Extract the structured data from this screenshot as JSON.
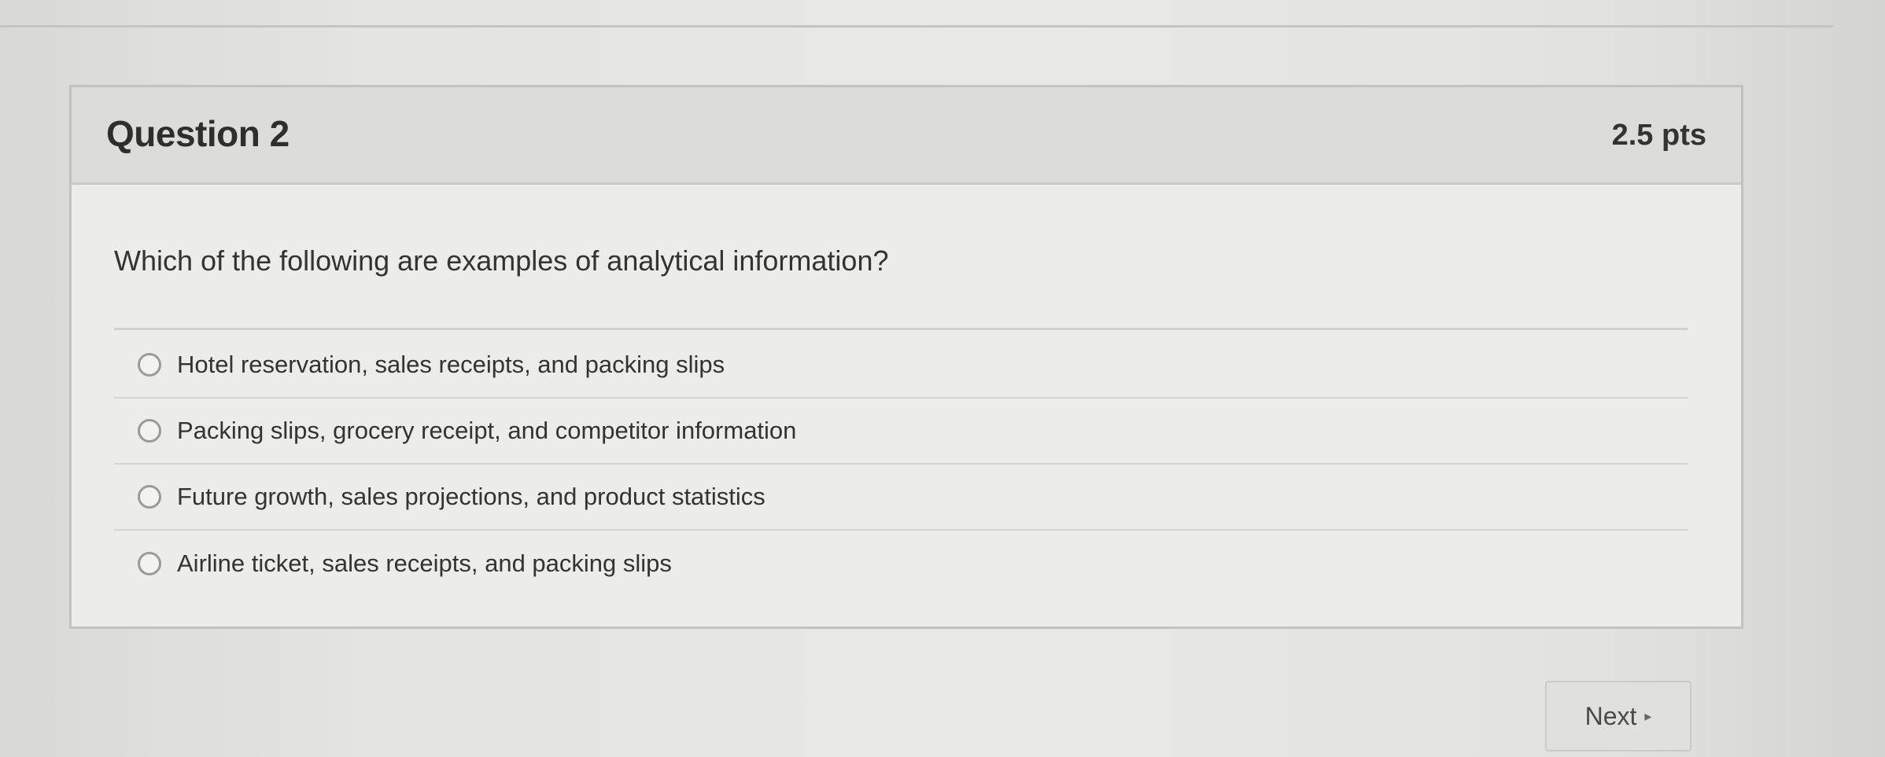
{
  "question": {
    "title": "Question 2",
    "points": "2.5 pts",
    "text": "Which of the following are examples of analytical information?",
    "answers": [
      {
        "label": "Hotel reservation, sales receipts, and packing slips",
        "selected": false
      },
      {
        "label": "Packing slips, grocery receipt, and competitor information",
        "selected": false
      },
      {
        "label": "Future growth, sales projections, and product statistics",
        "selected": false
      },
      {
        "label": "Airline ticket, sales receipts, and packing slips",
        "selected": false
      }
    ]
  },
  "navigation": {
    "next_label": "Next",
    "next_icon": "arrow-right-icon"
  }
}
